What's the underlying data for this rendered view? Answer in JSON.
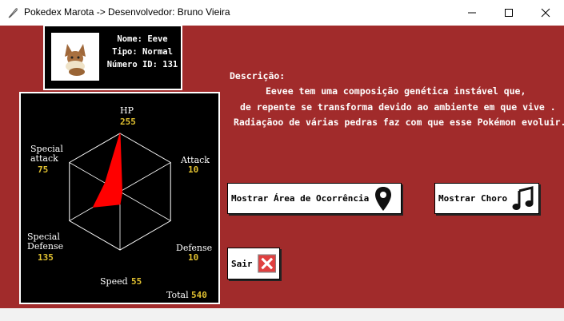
{
  "window": {
    "title": "Pokedex Marota -> Desenvolvedor: Bruno Vieira",
    "background": "#a12b2b"
  },
  "card": {
    "name_line": "Nome: Eeve",
    "type_line": "Tipo: Normal",
    "id_line": "Número ID: 131",
    "sprite": "eevee-sprite"
  },
  "description": {
    "heading": "Descrição:",
    "line1": "Eevee tem uma composição genética instável que,",
    "line2": "de repente se transforma devido ao ambiente em que vive .",
    "line3": "Radiaçãoo de várias pedras faz com que esse Pokémon evoluir."
  },
  "buttons": {
    "area": "Mostrar Área de Ocorrência",
    "area_icon": "map-pin-icon",
    "cry": "Mostrar Choro",
    "cry_icon": "music-note-icon",
    "exit": "Sair",
    "exit_icon": "close-x-icon"
  },
  "chart_data": {
    "type": "radar",
    "max": 255,
    "fill_color": "#ff0000",
    "axes": [
      {
        "label": "HP",
        "value": 255
      },
      {
        "label": "Attack",
        "value": 10
      },
      {
        "label": "Defense",
        "value": 10
      },
      {
        "label": "Speed",
        "value": 55
      },
      {
        "label": "Special Defense",
        "value": 135
      },
      {
        "label": "Special attack",
        "value": 75
      }
    ],
    "total_label": "Total",
    "total": 540,
    "grid": true
  }
}
